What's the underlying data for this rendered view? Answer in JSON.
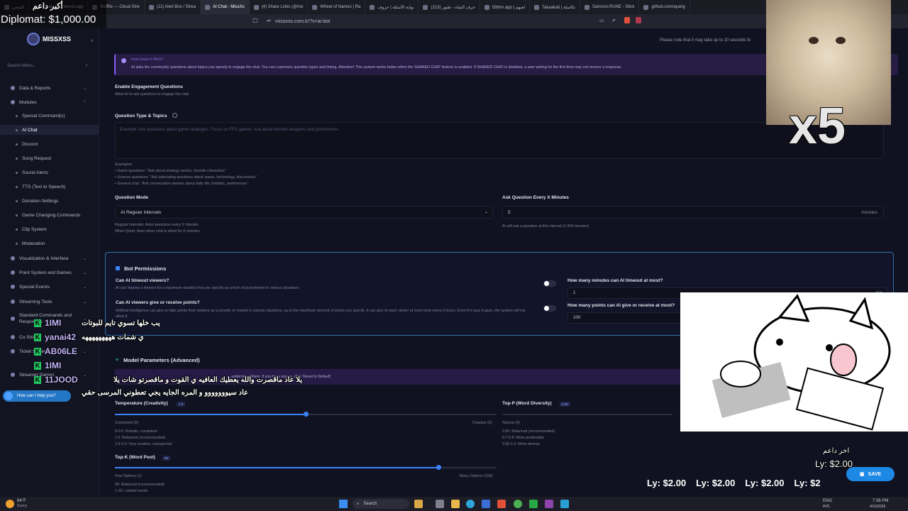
{
  "browser": {
    "tabs": [
      {
        "label": "الشحن"
      },
      {
        "label": "killingames.vercel.app"
      },
      {
        "label": "BotRix — Cloud Stre"
      },
      {
        "label": "(11) Alert Box / Strea"
      },
      {
        "label": "AI Chat - MissXs",
        "active": true
      },
      {
        "label": "(4) Share Links (@mo"
      },
      {
        "label": "Wheel of Names | Ra"
      },
      {
        "label": "بوابة الأسئلة | حروف"
      },
      {
        "label": "(213) حرف الشاه - طيور"
      },
      {
        "label": "l3bhm.app | لعبهم"
      },
      {
        "label": "Takaakali | تكاسلة"
      },
      {
        "label": "Samson-RUNE - Stick"
      },
      {
        "label": "github.com/ayang"
      }
    ],
    "url": "missxss.com.tr/?s=ai-bot",
    "notice": "Please note that it may take up to 10 seconds fo"
  },
  "sidebar": {
    "brand": "MISSXSS",
    "search_placeholder": "Search Menu...",
    "items": [
      {
        "label": "Data & Reports",
        "type": "group"
      },
      {
        "label": "Modules",
        "type": "group"
      },
      {
        "label": "Special Command(s)",
        "type": "sub"
      },
      {
        "label": "AI Chat",
        "type": "sub",
        "active": true
      },
      {
        "label": "Discord",
        "type": "sub"
      },
      {
        "label": "Song Request",
        "type": "sub"
      },
      {
        "label": "Sound Alerts",
        "type": "sub"
      },
      {
        "label": "TTS (Text to Speech)",
        "type": "sub"
      },
      {
        "label": "Donation Settings",
        "type": "sub"
      },
      {
        "label": "Game Changing Commands",
        "type": "sub"
      },
      {
        "label": "Clip System",
        "type": "sub"
      },
      {
        "label": "Moderation",
        "type": "sub"
      },
      {
        "label": "Visualization & Interface",
        "type": "group"
      },
      {
        "label": "Point System and Games",
        "type": "group"
      },
      {
        "label": "Special Events",
        "type": "group"
      },
      {
        "label": "Streaming Tools",
        "type": "group"
      },
      {
        "label": "Standard Commands and Responses",
        "type": "group"
      },
      {
        "label": "Co-Stream",
        "type": "group"
      },
      {
        "label": "Ticket System",
        "type": "group"
      },
      {
        "label": "Streamer Games",
        "type": "group"
      }
    ],
    "help": "How can I help you?"
  },
  "main": {
    "how_title": "How Does It Work?",
    "how_text": "AI asks the community questions about topics you specify to engage the chat. You can customize question types and timing. Attention! This system works better when the SHARED CHAT feature is enabled. If SHARED CHAT is disabled, a user writing for the first time may not receive a response.",
    "engage_label": "Enable Engagement Questions",
    "engage_desc": "Allow AI to ask questions to engage the chat",
    "qtype_label": "Question Type & Topics",
    "qtype_placeholder": "Example: Ask questions about game strategies. Focus on FPS games. Ask about favorite weapons and preferences.",
    "examples_title": "Examples:",
    "examples": [
      "• Game questions: \"Ask about strategy, tactics, favorite characters\"",
      "• Science questions: \"Ask interesting questions about space, technology, discoveries\"",
      "• General chat: \"Ask conversation starters about daily life, hobbies, preferences\""
    ],
    "qmode_label": "Question Mode",
    "qmode_value": "At Regular Intervals",
    "qmode_help1": "Regular Intervals: Asks questions every X minutes",
    "qmode_help2": "When Quiet: Asks when chat is silent for X minutes",
    "every_label": "Ask Question Every X Minutes",
    "every_value": "5",
    "every_unit": "minutes",
    "every_help": "AI will ask a question at this interval (1-350 minutes)",
    "perm_title": "Bot Permissions",
    "timeout_label": "Can AI timeout viewers?",
    "timeout_desc": "AI can impose a timeout for a maximum duration that you specify as a form of punishment in various situations",
    "points_label": "Can AI viewers give or receive points?",
    "points_desc": "Artificial intelligence can give or take points from viewers as a penalty or reward in various situations, up to the maximum amount of points you specify. It can give to each viewer at most once every 6 hours. Even if it says it gave, the system will not allow it",
    "max_min_label": "How many minutes can AI timeout at most?",
    "max_min_value": "1",
    "max_min_unit": "min",
    "max_pts_label": "How many points can AI give or receive at most?",
    "max_pts_value": "100",
    "max_pts_unit": "point",
    "model_title": "Model Parameters (Advanced)",
    "model_notice": "...understand them. If you have issues, click 'Reset to Default'.",
    "temp_label": "Temperature (Creativity)",
    "temp_value": "1.0",
    "temp_min": "Consistent (0)",
    "temp_max": "Creative (2)",
    "temp_help": [
      "0-0.5: Robotic, consistent",
      "1.0: Balanced (recommended)",
      "1.5-2.0: Very creative, unexpected"
    ],
    "topp_label": "Top-P (Word Diversity)",
    "topp_value": "0.90",
    "topp_min": "Narrow (0)",
    "topp_help": [
      "0.90: Balanced (recommended)",
      "0.7-0.8: More predictable",
      "0.95-1.0: More diverse"
    ],
    "topk_label": "Top-K (Word Pool)",
    "topk_value": "85",
    "topk_min": "Few Options (1)",
    "topk_max": "Many Options (100)",
    "topk_help": [
      "85: Balanced (recommended)",
      "1-20: Limited words"
    ],
    "save": "SAVE"
  },
  "overlay": {
    "top_left_name": "أكبر داعم",
    "top_left_amount": "Diplomat: $1,000.00",
    "x5": "x5",
    "chat": [
      {
        "user": "1IMI",
        "msg": "يب خلها تسوي تايم للبوتات"
      },
      {
        "user": "yanai42",
        "msg": "ي شمات هههههههههه"
      },
      {
        "user": "AB06LE",
        "msg": ""
      },
      {
        "user": "1IMI",
        "msg": ""
      },
      {
        "user": "11JOOD",
        "msg": "يلا عاد ماقصرت والله يعطيك العافيه ي القوت و ماقصرتو شات يلا"
      },
      {
        "user": "",
        "msg": "عاد سيووووووو و المره الجايه يجي تعطوني المرسى حقي"
      }
    ],
    "last_label": "اخر داعم",
    "last_amount": "Ly: $2.00",
    "ticker": [
      "Ly: $2.00",
      "Ly: $2.00",
      "Ly: $2.00",
      "Ly: $2"
    ]
  },
  "taskbar": {
    "weather": "84°F",
    "weather_sub": "Sunny",
    "search": "Search",
    "lang": "ENG",
    "lang_sub": "INTL",
    "time": "7:36 PM",
    "date": "4/10/2026"
  }
}
